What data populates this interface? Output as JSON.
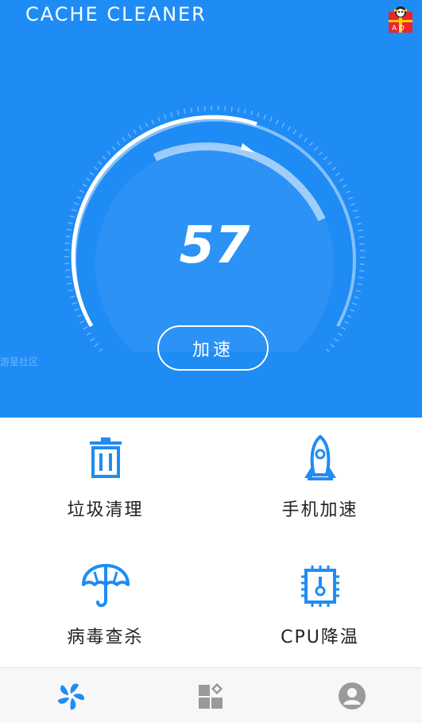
{
  "header": {
    "app_title": "CACHE CLEANER",
    "ad_badge_text": "A  D"
  },
  "gauge": {
    "score": "57",
    "boost_button_label": "加速"
  },
  "watermark": "游星社区",
  "features": [
    {
      "label": "垃圾清理",
      "icon": "trash-icon"
    },
    {
      "label": "手机加速",
      "icon": "rocket-icon"
    },
    {
      "label": "病毒查杀",
      "icon": "umbrella-icon"
    },
    {
      "label": "CPU降温",
      "icon": "cpu-chip-icon"
    }
  ],
  "bottom_nav": [
    {
      "icon": "fan-icon",
      "active": true
    },
    {
      "icon": "apps-grid-icon",
      "active": false
    },
    {
      "icon": "user-profile-icon",
      "active": false
    }
  ],
  "colors": {
    "primary": "#1f8cf5",
    "nav_active": "#1f8cf5",
    "nav_inactive": "#9a9a9a",
    "text_dark": "#222222"
  }
}
